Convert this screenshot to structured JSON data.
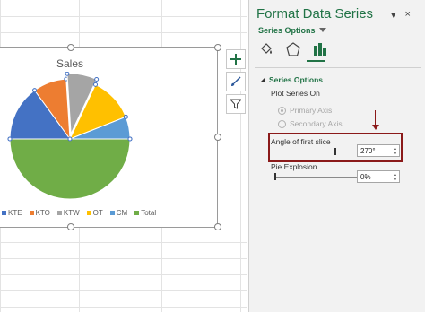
{
  "pane": {
    "title": "Format Data Series",
    "series_options_menu": "Series Options",
    "close_glyph": "×",
    "dropdown_glyph": "▾",
    "section_title": "Series Options",
    "plot_series_on": "Plot Series On",
    "primary_axis": "Primary Axis",
    "secondary_axis": "Secondary Axis",
    "angle_label": "Angle of first slice",
    "angle_value": "270°",
    "pie_explosion_label": "Pie Explosion",
    "pie_explosion_value": "0%"
  },
  "chart": {
    "title": "Sales",
    "legend": [
      {
        "label": "KTE",
        "color": "#4472c4"
      },
      {
        "label": "KTO",
        "color": "#ed7d31"
      },
      {
        "label": "KTW",
        "color": "#a5a5a5"
      },
      {
        "label": "OT",
        "color": "#ffc000"
      },
      {
        "label": "CM",
        "color": "#5b9bd5"
      },
      {
        "label": "Total",
        "color": "#70ad47"
      }
    ]
  },
  "chart_data": {
    "type": "pie",
    "title": "Sales",
    "first_slice_angle_deg": 270,
    "labels": [
      "KTE",
      "KTO",
      "KTW",
      "OT",
      "CM",
      "Total"
    ],
    "values": [
      15,
      9,
      8,
      12,
      6,
      50
    ],
    "colors": [
      "#4472c4",
      "#ed7d31",
      "#a5a5a5",
      "#ffc000",
      "#5b9bd5",
      "#70ad47"
    ],
    "exploded": [
      "KTW"
    ],
    "legend_position": "bottom"
  },
  "icons": {
    "add_element": "plus-icon",
    "chart_styles": "brush-icon",
    "chart_filters": "filter-icon"
  }
}
